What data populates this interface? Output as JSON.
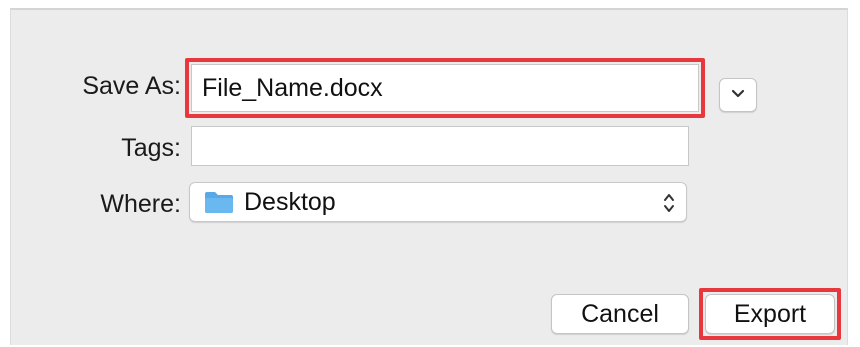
{
  "dialog": {
    "save_as": {
      "label": "Save As:",
      "value": "File_Name.docx"
    },
    "tags": {
      "label": "Tags:",
      "value": ""
    },
    "where": {
      "label": "Where:",
      "selected": "Desktop"
    },
    "buttons": {
      "cancel": "Cancel",
      "export": "Export"
    }
  },
  "icons": {
    "expand": "chevron-down-icon",
    "folder": "folder-icon",
    "stepper": "up-down-chevron-icon"
  },
  "colors": {
    "highlight": "#e8383d",
    "folder": "#5aa9e6",
    "dialog_background": "#ececec"
  }
}
